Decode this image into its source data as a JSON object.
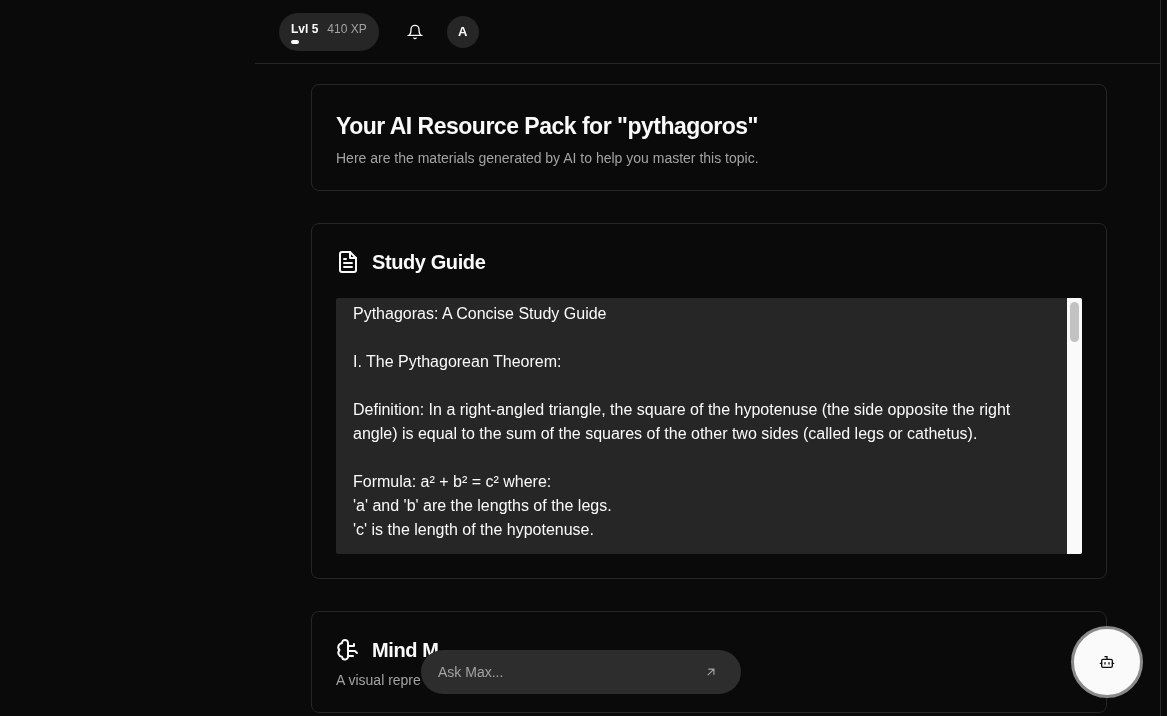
{
  "top_bar": {
    "level_label": "Lvl 5",
    "xp": "410 XP",
    "xp_progress": {
      "level": 0.2
    },
    "avatar": "A"
  },
  "header_card": {
    "title": "Your AI Resource Pack for \"pythagoros\"",
    "subtitle": "Here are the materials generated by AI to help you master this topic."
  },
  "study_guide": {
    "title": "Study Guide",
    "paragraphs": [
      [
        "Pythagoras: A Concise Study Guide"
      ],
      [
        "I. The Pythagorean Theorem:"
      ],
      [
        "Definition: In a right-angled triangle, the square of the hypotenuse (the side opposite the right angle) is equal to the sum of the squares of the other two sides (called legs or cathetus)."
      ],
      [
        "Formula: a² + b² = c² where:",
        "'a' and 'b' are the lengths of the legs.",
        "'c' is the length of the hypotenuse."
      ]
    ]
  },
  "mind_map": {
    "title": "Mind M",
    "subtitle": "A visual repre"
  },
  "ask_field": {
    "placeholder": "Ask Max..."
  }
}
